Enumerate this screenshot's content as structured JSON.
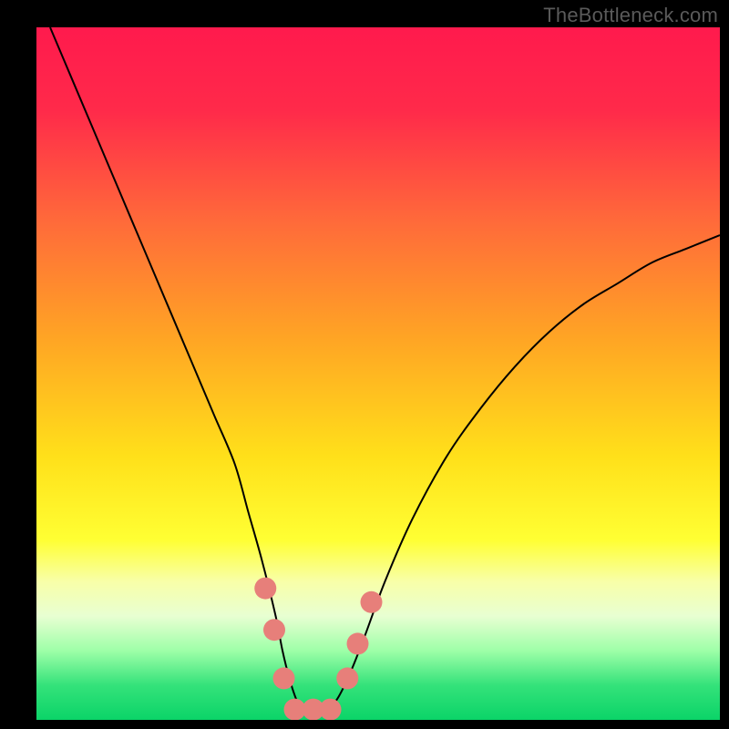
{
  "watermark": "TheBottleneck.com",
  "chart_data": {
    "type": "line",
    "title": "",
    "xlabel": "",
    "ylabel": "",
    "xlim": [
      0,
      100
    ],
    "ylim": [
      0,
      100
    ],
    "background_gradient_stops": [
      {
        "offset": 0.0,
        "color": "#ff1a4d"
      },
      {
        "offset": 0.12,
        "color": "#ff2a4a"
      },
      {
        "offset": 0.28,
        "color": "#ff6a3a"
      },
      {
        "offset": 0.45,
        "color": "#ffa524"
      },
      {
        "offset": 0.62,
        "color": "#ffe01a"
      },
      {
        "offset": 0.74,
        "color": "#ffff33"
      },
      {
        "offset": 0.8,
        "color": "#f8ffa8"
      },
      {
        "offset": 0.85,
        "color": "#e8ffd2"
      },
      {
        "offset": 0.9,
        "color": "#9effa8"
      },
      {
        "offset": 0.95,
        "color": "#34e27a"
      },
      {
        "offset": 1.0,
        "color": "#0bd468"
      }
    ],
    "series": [
      {
        "name": "curve",
        "stroke": "#000000",
        "stroke_width": 2,
        "x": [
          2,
          5,
          8,
          11,
          14,
          17,
          20,
          23,
          26,
          29,
          31,
          33,
          35,
          36,
          37,
          38,
          39,
          40,
          42,
          44,
          46,
          48,
          51,
          55,
          60,
          65,
          70,
          75,
          80,
          85,
          90,
          95,
          100
        ],
        "y": [
          100,
          93,
          86,
          79,
          72,
          65,
          58,
          51,
          44,
          37,
          30,
          23,
          15,
          10,
          6,
          3,
          1,
          1,
          1,
          3,
          7,
          12,
          20,
          29,
          38,
          45,
          51,
          56,
          60,
          63,
          66,
          68,
          70
        ]
      }
    ],
    "markers": {
      "color": "#e77f7a",
      "radius": 12,
      "points": [
        {
          "x": 33.5,
          "y": 19
        },
        {
          "x": 34.8,
          "y": 13
        },
        {
          "x": 36.2,
          "y": 6
        },
        {
          "x": 37.8,
          "y": 1.5
        },
        {
          "x": 40.5,
          "y": 1.5
        },
        {
          "x": 43.0,
          "y": 1.5
        },
        {
          "x": 45.5,
          "y": 6
        },
        {
          "x": 47.0,
          "y": 11
        },
        {
          "x": 49.0,
          "y": 17
        }
      ]
    }
  }
}
